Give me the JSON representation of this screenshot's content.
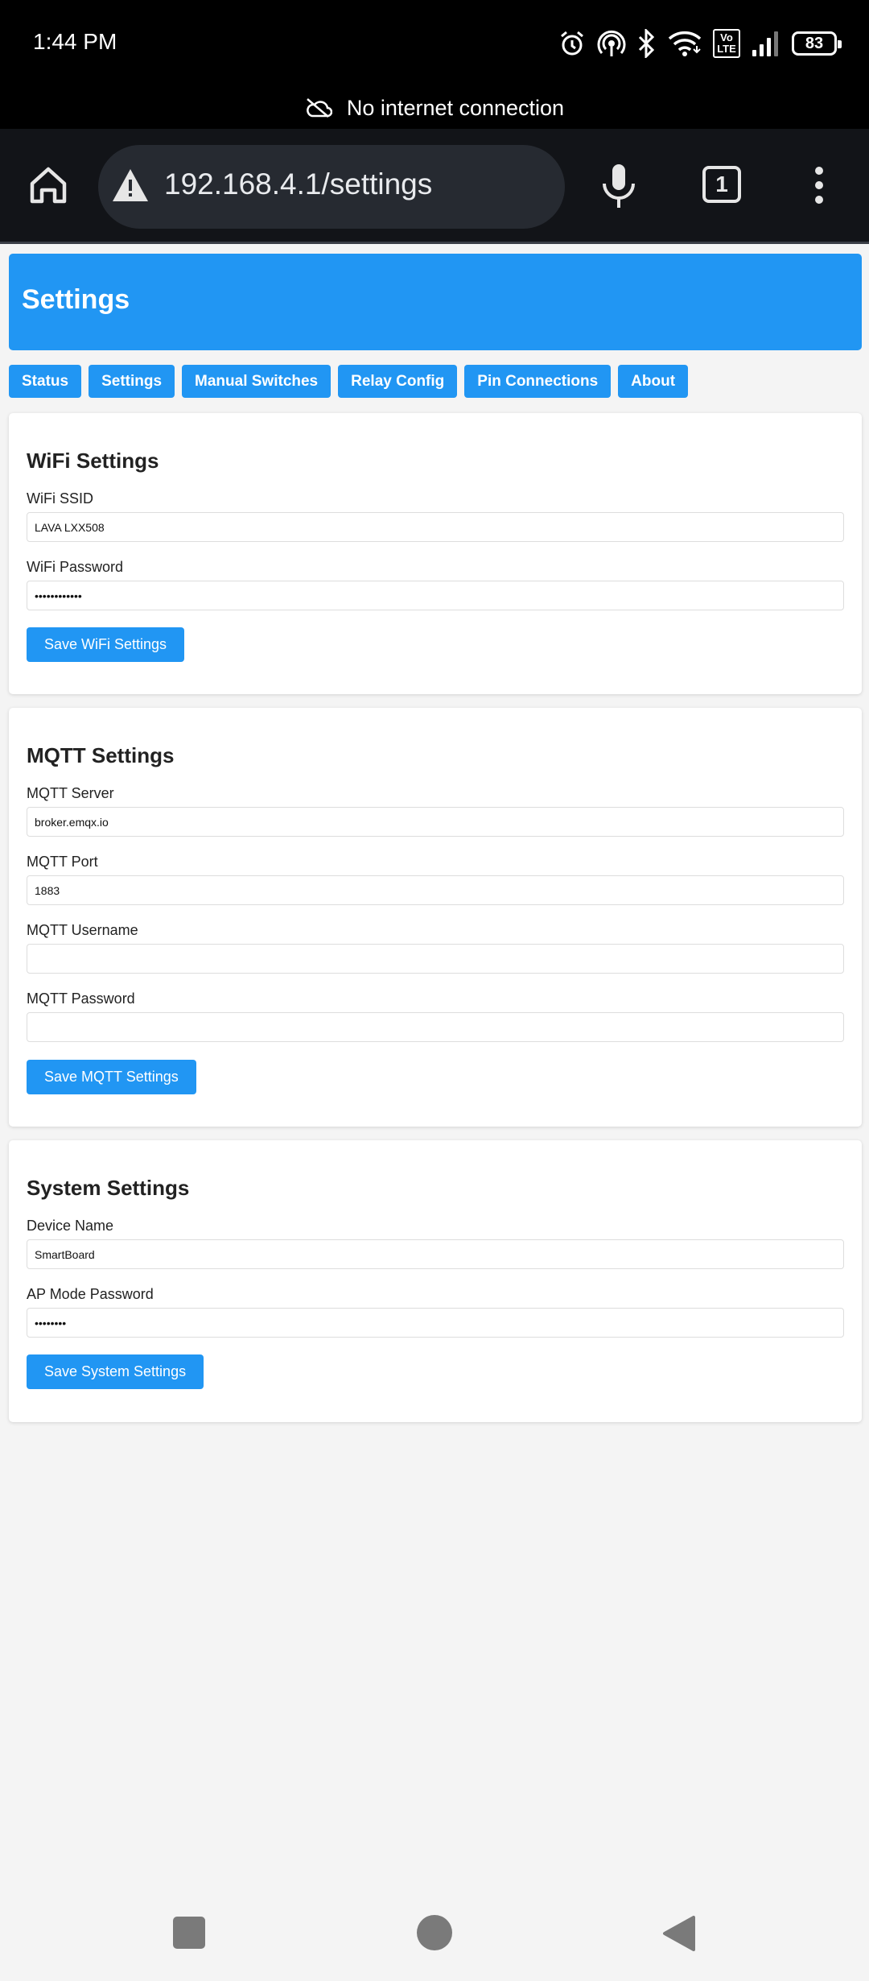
{
  "status_bar": {
    "time": "1:44 PM",
    "battery": "83",
    "icons": [
      "alarm-icon",
      "hotspot-icon",
      "bluetooth-icon",
      "wifi-icon",
      "volte-icon",
      "signal-icon",
      "battery-icon"
    ],
    "volte_line1": "Vo",
    "volte_line2": "LTE"
  },
  "offline_banner": {
    "text": "No internet connection",
    "icon": "cloud-off-icon"
  },
  "browser": {
    "url": "192.168.4.1/settings",
    "tab_count": "1",
    "icons": [
      "home-icon",
      "warning-icon",
      "mic-icon",
      "tabs-icon",
      "more-vert-icon"
    ]
  },
  "page": {
    "title": "Settings",
    "nav": [
      "Status",
      "Settings",
      "Manual Switches",
      "Relay Config",
      "Pin Connections",
      "About"
    ],
    "accent_color": "#2196f3"
  },
  "wifi": {
    "title": "WiFi Settings",
    "ssid_label": "WiFi SSID",
    "ssid_value": "LAVA LXX508",
    "password_label": "WiFi Password",
    "password_value": "••••••••••••",
    "save_label": "Save WiFi Settings"
  },
  "mqtt": {
    "title": "MQTT Settings",
    "server_label": "MQTT Server",
    "server_value": "broker.emqx.io",
    "port_label": "MQTT Port",
    "port_value": "1883",
    "username_label": "MQTT Username",
    "username_value": "",
    "password_label": "MQTT Password",
    "password_value": "",
    "save_label": "Save MQTT Settings"
  },
  "system": {
    "title": "System Settings",
    "device_label": "Device Name",
    "device_value": "SmartBoard",
    "ap_label": "AP Mode Password",
    "ap_value": "••••••••",
    "save_label": "Save System Settings"
  },
  "system_nav": [
    "recents-icon",
    "home-circle-icon",
    "back-icon"
  ]
}
